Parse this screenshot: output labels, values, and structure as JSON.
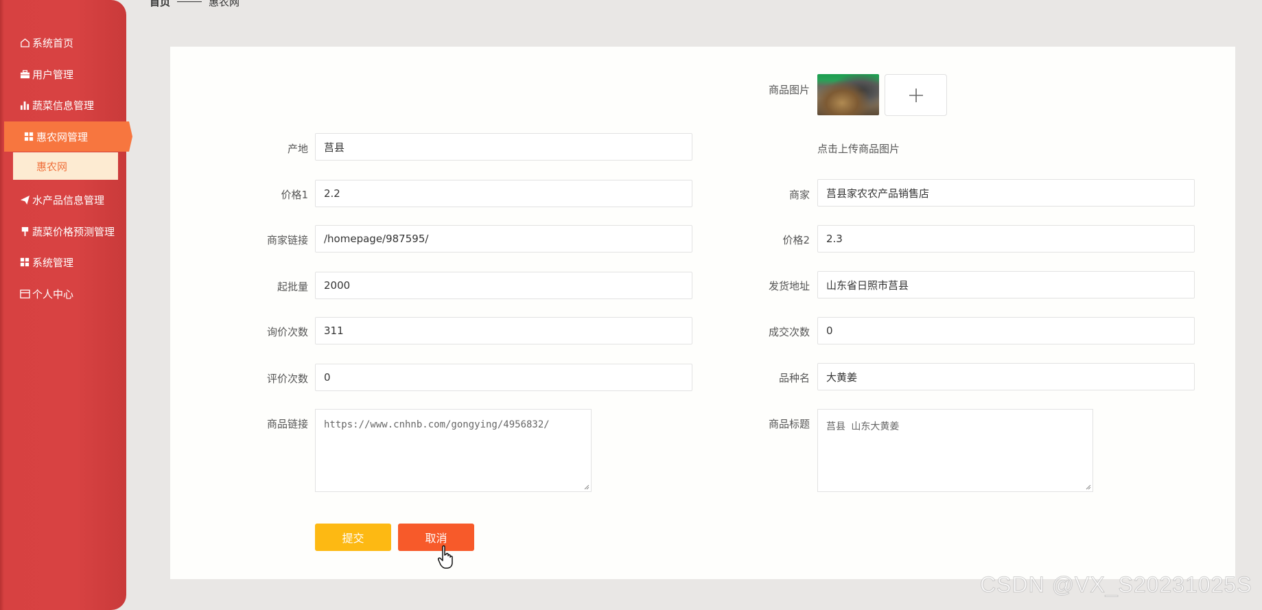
{
  "breadcrumb": {
    "home": "首页",
    "current": "惠农网"
  },
  "sidebar": {
    "items": [
      {
        "label": "系统首页",
        "icon": "home-icon"
      },
      {
        "label": "用户管理",
        "icon": "briefcase-icon"
      },
      {
        "label": "蔬菜信息管理",
        "icon": "bar-chart-icon"
      },
      {
        "label": "惠农网管理",
        "icon": "grid-icon",
        "active": true
      },
      {
        "label": "水产品信息管理",
        "icon": "paper-plane-icon"
      },
      {
        "label": "蔬菜价格预测管理",
        "icon": "pin-icon"
      },
      {
        "label": "系统管理",
        "icon": "grid-icon"
      },
      {
        "label": "个人中心",
        "icon": "window-icon"
      }
    ],
    "sub_item": "惠农网"
  },
  "form": {
    "image_label": "商品图片",
    "upload_hint": "点击上传商品图片",
    "origin": {
      "label": "产地",
      "value": "莒县"
    },
    "price1": {
      "label": "价格1",
      "value": "2.2"
    },
    "merchant": {
      "label": "商家",
      "value": "莒县家农农产品销售店"
    },
    "merchant_link": {
      "label": "商家链接",
      "value": "/homepage/987595/"
    },
    "price2": {
      "label": "价格2",
      "value": "2.3"
    },
    "min_batch": {
      "label": "起批量",
      "value": "2000"
    },
    "ship_address": {
      "label": "发货地址",
      "value": "山东省日照市莒县"
    },
    "inquiry_count": {
      "label": "询价次数",
      "value": "311"
    },
    "deal_count": {
      "label": "成交次数",
      "value": "0"
    },
    "review_count": {
      "label": "评价次数",
      "value": "0"
    },
    "variety": {
      "label": "品种名",
      "value": "大黄姜"
    },
    "product_link": {
      "label": "商品链接",
      "value": "https://www.cnhnb.com/gongying/4956832/"
    },
    "product_title": {
      "label": "商品标题",
      "value": "莒县 山东大黄姜"
    }
  },
  "buttons": {
    "submit": "提交",
    "cancel": "取消"
  },
  "colors": {
    "sidebar": "#d84242",
    "active": "#f7763f",
    "submit": "#fdb913",
    "cancel": "#f75a2a"
  },
  "watermark": "CSDN @VX_S20231025S"
}
